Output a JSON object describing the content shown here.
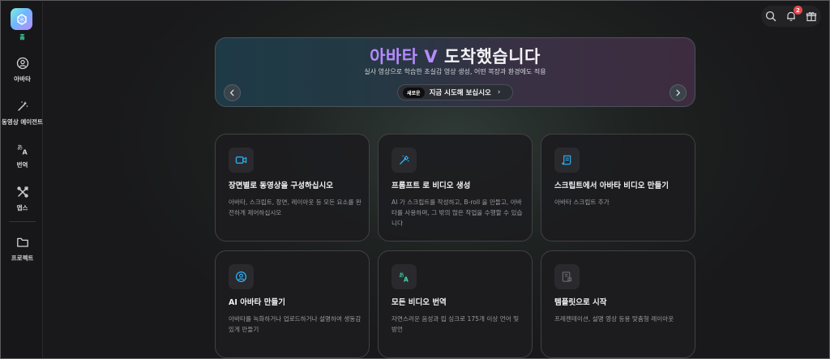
{
  "app": {
    "logo_label": "홈"
  },
  "sidebar": {
    "items": [
      {
        "label": "아바타",
        "icon": "user-circle-icon"
      },
      {
        "label": "동영상 에이전트",
        "icon": "magic-wand-icon"
      },
      {
        "label": "번역",
        "icon": "translate-icon"
      },
      {
        "label": "앱스",
        "icon": "apps-icon"
      },
      {
        "label": "프로젝트",
        "icon": "folder-icon"
      }
    ]
  },
  "topbar": {
    "notification_count": "2"
  },
  "banner": {
    "title_highlight": "아바타 V",
    "title_rest": " 도착했습니다",
    "subtitle": "실사 영상으로 학습한 초실감 영상 생성, 어떤 복장과 환경에도 적용",
    "cta_tag": "새로운",
    "cta_label": "지금 시도해 보십시오",
    "cta_chevron": "›"
  },
  "cards": [
    {
      "title": "장면별로 동영상을 구성하십시오",
      "desc": "아바타, 스크립트, 장면, 레이아웃 등 모든 요소를 완전하게 제어하십시오",
      "icon": "video-camera-icon",
      "accent": "#2bb6ff"
    },
    {
      "title": "프롬프트 로 비디오 생성",
      "desc": "AI 가 스크립트를 작성하고, B-roll 을 만들고, 아바타를 사용하며, 그 밖의 많은 작업을 수행할 수 있습니다",
      "icon": "magic-wand-icon",
      "accent": "#2bb6ff"
    },
    {
      "title": "스크립트에서 아바타 비디오 만들기",
      "desc": "아바타 스크립트 추가",
      "icon": "script-icon",
      "accent": "#2bb6ff"
    },
    {
      "title": "AI 아바타 만들기",
      "desc": "아바타를 녹화하거나 업로드하거나 설명하여 생동감 있게 만들기",
      "icon": "user-circle-icon",
      "accent": "#2bb6ff"
    },
    {
      "title": "모든 비디오 번역",
      "desc": "자연스러운 음성과 립 싱크로 175개 이상 언어 및 방언",
      "icon": "translate-icon",
      "accent": "#3fe0a5"
    },
    {
      "title": "템플릿으로 시작",
      "desc": "프레젠테이션, 설명 영상 등용 맞춤형 레이아웃",
      "icon": "template-icon",
      "accent": "#6a6a70"
    }
  ]
}
